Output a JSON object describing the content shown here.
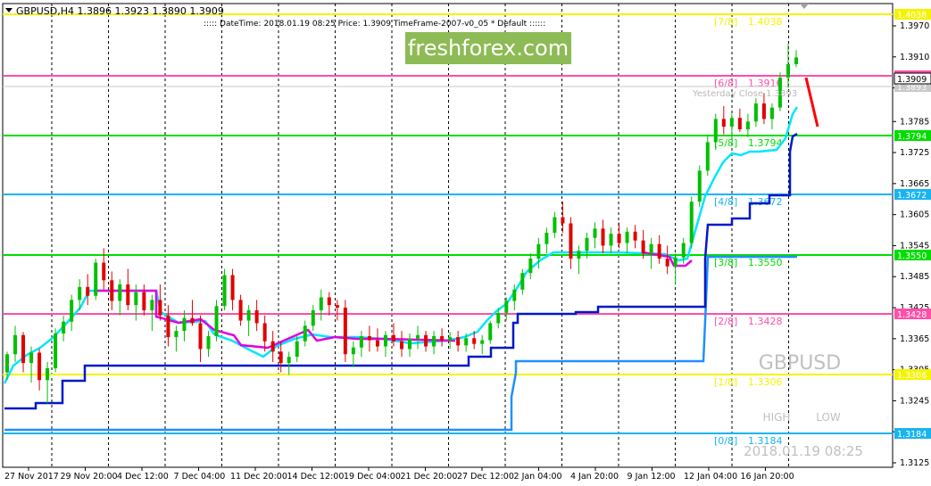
{
  "header": {
    "symbol_line": "GBPUSD,H4  1.3896 1.3923 1.3890 1.3909",
    "info_line": "::::: DateTime: 2018.01.19 08:25    Price: 1.3909    TimeFrame-2007-v0_05    *  Default   ::::::"
  },
  "watermark": {
    "logo_text": "freshforex.com",
    "symbol": "GBPUSD",
    "datetime": "2018.01.19 08:25",
    "high_label": "HIGH",
    "low_label": "LOW"
  },
  "yesterday_close_label": "Yesterday Close 1.3893",
  "colors": {
    "bull": "#00c000",
    "bear": "#e00000",
    "cyan_line": "#00e5ff",
    "magenta_line": "#e000e0",
    "dark_blue_line": "#0018c8",
    "light_blue_line": "#1e90ff",
    "green_level": "#00dd00",
    "yellow_level": "#f4f400",
    "pink_level": "#ff4fa8",
    "blue_level": "#18b4f0",
    "trend_arrow": "#ff0000"
  },
  "chart_data": {
    "type": "candlestick",
    "symbol": "GBPUSD",
    "timeframe": "H4",
    "last_price": 1.3909,
    "ylim": [
      1.3108,
      1.3998
    ],
    "y_ticks": [
      1.3125,
      1.3185,
      1.3245,
      1.3305,
      1.3365,
      1.3425,
      1.3485,
      1.3545,
      1.3605,
      1.3665,
      1.3725,
      1.3785,
      1.385,
      1.391,
      1.397
    ],
    "x_tick_labels": [
      "27 Nov 2017",
      "29 Nov 20:00",
      "4 Dec 12:00",
      "7 Dec 04:00",
      "11 Dec 20:00",
      "14 Dec 12:00",
      "19 Dec 04:00",
      "21 Dec 20:00",
      "27 Dec 12:00",
      "2 Jan 04:00",
      "4 Jan 20:00",
      "9 Jan 12:00",
      "12 Jan 04:00",
      "16 Jan 20:00"
    ],
    "murrey_levels": [
      {
        "label": "[7/8]",
        "value": 1.4038,
        "color": "#f4f400",
        "axis_label": "1.4038"
      },
      {
        "label": "[6/8]",
        "value": 1.3916,
        "color": "#ff4fa8",
        "axis_label": "1.3916"
      },
      {
        "label": "[5/8]",
        "value": 1.3794,
        "color": "#00dd00",
        "axis_label": "1.3794"
      },
      {
        "label": "[4/8]",
        "value": 1.3672,
        "color": "#18b4f0",
        "axis_label": "1.3672"
      },
      {
        "label": "[3/8]",
        "value": 1.355,
        "color": "#00dd00",
        "axis_label": "1.3550"
      },
      {
        "label": "[2/8]",
        "value": 1.3428,
        "color": "#ff4fa8",
        "axis_label": "1.3428"
      },
      {
        "label": "[1/8]",
        "value": 1.3306,
        "color": "#f4f400",
        "axis_label": "1.3306"
      },
      {
        "label": "[0/8]",
        "value": 1.3184,
        "color": "#18b4f0",
        "axis_label": "1.3184"
      }
    ],
    "yesterday_close": 1.3893,
    "candles": [
      [
        1.33,
        1.334,
        1.3285,
        1.3335
      ],
      [
        1.3335,
        1.339,
        1.332,
        1.3372
      ],
      [
        1.3372,
        1.3378,
        1.33,
        1.3318
      ],
      [
        1.3318,
        1.335,
        1.328,
        1.3338
      ],
      [
        1.3338,
        1.3345,
        1.3265,
        1.3285
      ],
      [
        1.3285,
        1.332,
        1.324,
        1.3308
      ],
      [
        1.3308,
        1.3385,
        1.33,
        1.3375
      ],
      [
        1.3375,
        1.341,
        1.336,
        1.3398
      ],
      [
        1.3398,
        1.345,
        1.338,
        1.344
      ],
      [
        1.344,
        1.348,
        1.342,
        1.3465
      ],
      [
        1.3465,
        1.349,
        1.343,
        1.3448
      ],
      [
        1.3448,
        1.352,
        1.344,
        1.3512
      ],
      [
        1.3512,
        1.354,
        1.346,
        1.3478
      ],
      [
        1.3478,
        1.3495,
        1.342,
        1.3438
      ],
      [
        1.3438,
        1.348,
        1.341,
        1.347
      ],
      [
        1.347,
        1.35,
        1.342,
        1.343
      ],
      [
        1.343,
        1.347,
        1.34,
        1.3455
      ],
      [
        1.3455,
        1.347,
        1.341,
        1.342
      ],
      [
        1.342,
        1.345,
        1.338,
        1.344
      ],
      [
        1.344,
        1.347,
        1.34,
        1.341
      ],
      [
        1.341,
        1.343,
        1.335,
        1.3368
      ],
      [
        1.3368,
        1.339,
        1.334,
        1.338
      ],
      [
        1.338,
        1.342,
        1.336,
        1.3405
      ],
      [
        1.3405,
        1.344,
        1.339,
        1.3395
      ],
      [
        1.3395,
        1.341,
        1.332,
        1.3345
      ],
      [
        1.3345,
        1.338,
        1.333,
        1.337
      ],
      [
        1.337,
        1.344,
        1.336,
        1.3428
      ],
      [
        1.3428,
        1.35,
        1.342,
        1.3488
      ],
      [
        1.3488,
        1.35,
        1.342,
        1.344
      ],
      [
        1.344,
        1.345,
        1.339,
        1.34
      ],
      [
        1.34,
        1.343,
        1.337,
        1.342
      ],
      [
        1.342,
        1.344,
        1.338,
        1.3395
      ],
      [
        1.3395,
        1.341,
        1.334,
        1.336
      ],
      [
        1.336,
        1.338,
        1.332,
        1.334
      ],
      [
        1.334,
        1.336,
        1.33,
        1.3318
      ],
      [
        1.3318,
        1.334,
        1.3295,
        1.333
      ],
      [
        1.333,
        1.337,
        1.332,
        1.336
      ],
      [
        1.336,
        1.34,
        1.335,
        1.339
      ],
      [
        1.339,
        1.343,
        1.338,
        1.342
      ],
      [
        1.342,
        1.346,
        1.34,
        1.3445
      ],
      [
        1.3445,
        1.3455,
        1.341,
        1.343
      ],
      [
        1.343,
        1.344,
        1.34,
        1.3425
      ],
      [
        1.3425,
        1.344,
        1.332,
        1.3335
      ],
      [
        1.3335,
        1.336,
        1.331,
        1.3348
      ],
      [
        1.3348,
        1.338,
        1.333,
        1.337
      ],
      [
        1.337,
        1.339,
        1.334,
        1.3362
      ],
      [
        1.3362,
        1.3385,
        1.334,
        1.335
      ],
      [
        1.335,
        1.338,
        1.333,
        1.3372
      ],
      [
        1.3372,
        1.3395,
        1.335,
        1.336
      ],
      [
        1.336,
        1.338,
        1.333,
        1.3345
      ],
      [
        1.3345,
        1.3375,
        1.333,
        1.3365
      ],
      [
        1.3365,
        1.339,
        1.3345,
        1.3372
      ],
      [
        1.3372,
        1.338,
        1.334,
        1.335
      ],
      [
        1.335,
        1.338,
        1.3335,
        1.337
      ],
      [
        1.337,
        1.3385,
        1.335,
        1.3362
      ],
      [
        1.3362,
        1.3378,
        1.3345,
        1.3368
      ],
      [
        1.3368,
        1.338,
        1.334,
        1.3352
      ],
      [
        1.3352,
        1.3375,
        1.334,
        1.3366
      ],
      [
        1.3366,
        1.338,
        1.3345,
        1.3355
      ],
      [
        1.3355,
        1.3372,
        1.3335,
        1.3362
      ],
      [
        1.3362,
        1.34,
        1.3355,
        1.3395
      ],
      [
        1.3395,
        1.3425,
        1.3385,
        1.3415
      ],
      [
        1.3415,
        1.3445,
        1.34,
        1.3438
      ],
      [
        1.3438,
        1.347,
        1.342,
        1.346
      ],
      [
        1.346,
        1.35,
        1.345,
        1.3492
      ],
      [
        1.3492,
        1.353,
        1.348,
        1.352
      ],
      [
        1.352,
        1.356,
        1.35,
        1.3548
      ],
      [
        1.3548,
        1.358,
        1.353,
        1.357
      ],
      [
        1.357,
        1.361,
        1.356,
        1.36
      ],
      [
        1.36,
        1.363,
        1.357,
        1.3588
      ],
      [
        1.3588,
        1.36,
        1.35,
        1.352
      ],
      [
        1.352,
        1.3545,
        1.349,
        1.3535
      ],
      [
        1.3535,
        1.357,
        1.352,
        1.356
      ],
      [
        1.356,
        1.359,
        1.354,
        1.3578
      ],
      [
        1.3578,
        1.3595,
        1.353,
        1.3545
      ],
      [
        1.3545,
        1.358,
        1.353,
        1.3568
      ],
      [
        1.3568,
        1.359,
        1.354,
        1.355
      ],
      [
        1.355,
        1.358,
        1.353,
        1.3572
      ],
      [
        1.3572,
        1.3585,
        1.354,
        1.3555
      ],
      [
        1.3555,
        1.3575,
        1.352,
        1.353
      ],
      [
        1.353,
        1.356,
        1.35,
        1.3548
      ],
      [
        1.3548,
        1.3565,
        1.351,
        1.352
      ],
      [
        1.352,
        1.3545,
        1.349,
        1.3505
      ],
      [
        1.3505,
        1.353,
        1.347,
        1.3522
      ],
      [
        1.3522,
        1.356,
        1.351,
        1.355
      ],
      [
        1.355,
        1.364,
        1.354,
        1.363
      ],
      [
        1.363,
        1.37,
        1.362,
        1.369
      ],
      [
        1.369,
        1.376,
        1.368,
        1.3745
      ],
      [
        1.3745,
        1.38,
        1.373,
        1.379
      ],
      [
        1.379,
        1.3815,
        1.376,
        1.3775
      ],
      [
        1.3775,
        1.38,
        1.375,
        1.3792
      ],
      [
        1.3792,
        1.381,
        1.3765,
        1.377
      ],
      [
        1.377,
        1.38,
        1.3755,
        1.3785
      ],
      [
        1.3785,
        1.383,
        1.3775,
        1.382
      ],
      [
        1.382,
        1.384,
        1.378,
        1.379
      ],
      [
        1.379,
        1.382,
        1.377,
        1.3812
      ],
      [
        1.3812,
        1.388,
        1.3805,
        1.387
      ],
      [
        1.387,
        1.3935,
        1.385,
        1.3896
      ],
      [
        1.3896,
        1.3923,
        1.389,
        1.3909
      ]
    ]
  }
}
